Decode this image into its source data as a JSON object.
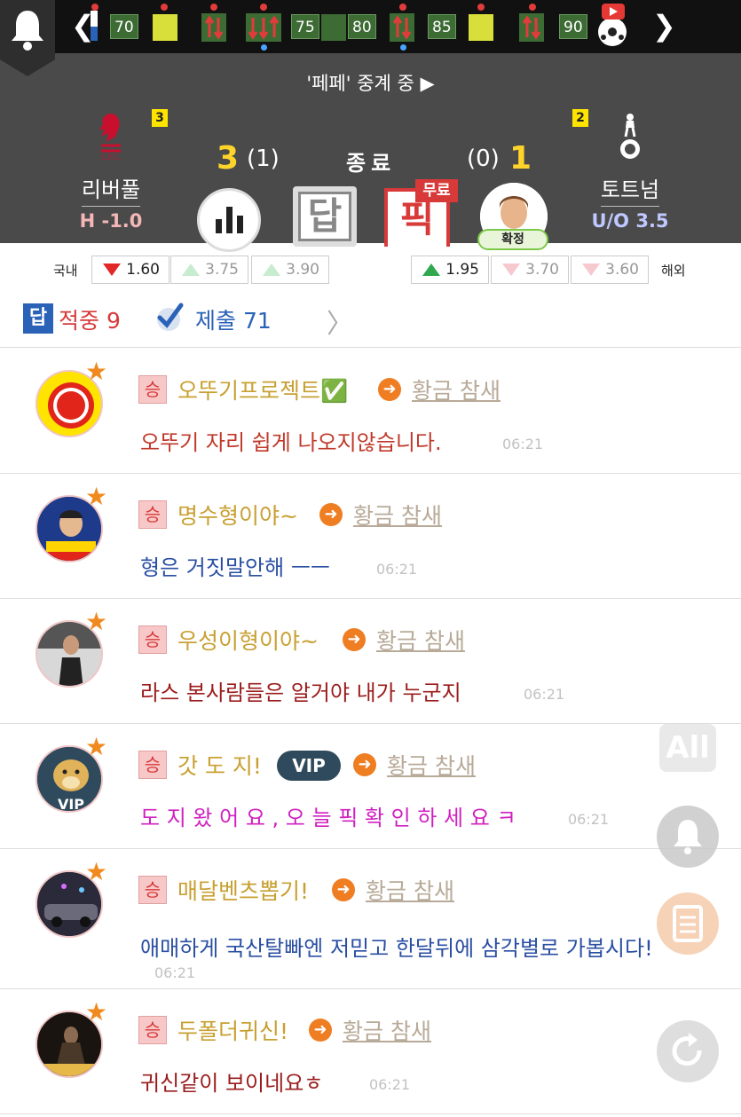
{
  "timeline": {
    "minutes": [
      "70",
      "75",
      "80",
      "85",
      "90"
    ],
    "colors": {
      "bar_bg": "#111111",
      "minute_bg": "#3d6b34",
      "yellow_card": "#d9df3a"
    }
  },
  "match": {
    "relay_text": "'페페' 중계 중 ▶",
    "home": {
      "name": "리버풀",
      "handicap": "H -1.0",
      "card_count": "3",
      "crest": "liverpool-crest-icon"
    },
    "away": {
      "name": "토트넘",
      "handicap": "U/O 3.5",
      "card_count": "2",
      "crest": "tottenham-crest-icon"
    },
    "score_home": "3",
    "score_home_ht": "(1)",
    "status": "종료",
    "score_away_ht": "(0)",
    "score_away": "1",
    "answer_label": "답",
    "pick_label": "픽",
    "free_label": "무료",
    "confirm_label": "확정",
    "colors": {
      "header_bg": "#4a4a4a",
      "score": "#ffd42a",
      "pick_red": "#d83a3a"
    }
  },
  "odds": {
    "domestic_label": "국내",
    "overseas_label": "해외",
    "domestic": [
      "1.60",
      "3.75",
      "3.90"
    ],
    "overseas": [
      "1.95",
      "3.70",
      "3.60"
    ]
  },
  "summary": {
    "hit_icon_label": "답",
    "hit_text": "적중 9",
    "submit_text": "제출 71",
    "chevron": "〉"
  },
  "comments": [
    {
      "badge": "승",
      "nick": "오뚜기프로젝트✅",
      "rank": "황금 참새",
      "message": "오뚜기 자리 쉽게 나오지않습니다.",
      "time": "06:21",
      "message_color": "#c0392b",
      "avatar": "ottogi-logo"
    },
    {
      "badge": "승",
      "nick": "명수형이야~",
      "rank": "황금 참새",
      "message": "형은 거짓말안해 ㅡㅡ",
      "time": "06:21",
      "message_color": "#2a4fa3",
      "avatar": "photo-person"
    },
    {
      "badge": "승",
      "nick": "우성이형이야~",
      "rank": "황금 참새",
      "message": "라스 본사람들은 알거야 내가 누군지",
      "time": "06:21",
      "message_color": "#9b1c1c",
      "avatar": "photo-person"
    },
    {
      "badge": "승",
      "nick": "갓 도 지!",
      "vip": "VIP",
      "rank": "황금 참새",
      "message": "도 지 왔 어 요 , 오 늘 픽 확 인 하 세 요 ㅋ",
      "time": "06:21",
      "message_color": "#d020c0",
      "avatar": "doge-vip"
    },
    {
      "badge": "승",
      "nick": "매달벤츠뽑기!",
      "rank": "황금 참새",
      "message": "애매하게 국산탈빠엔 저믿고 한달뒤에 삼각별로 가봅시다!",
      "time": "06:21",
      "message_color": "#2a4fa3",
      "avatar": "photo-car"
    },
    {
      "badge": "승",
      "nick": "두폴더귀신!",
      "rank": "황금 참새",
      "message": "귀신같이 보이네요ㅎ",
      "time": "06:21",
      "message_color": "#9b1c1c",
      "avatar": "photo-ghost"
    }
  ],
  "floating": {
    "all_label": "All"
  }
}
